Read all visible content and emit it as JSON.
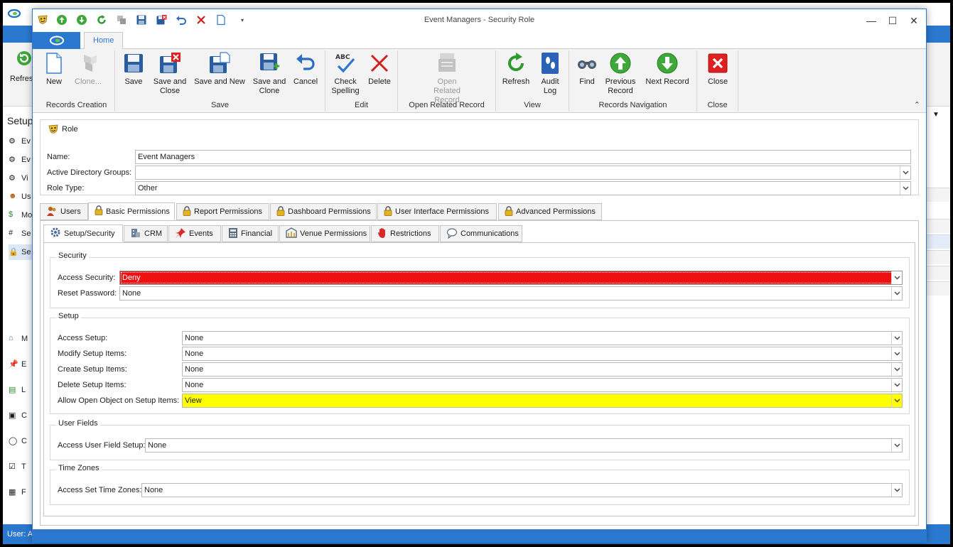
{
  "background": {
    "ribbon_left_label": "Refres",
    "sidebar_header": "Setup",
    "sidebar_items": [
      "Ev",
      "Ev",
      "Vi",
      "Us",
      "Mo",
      "Se",
      "Se"
    ],
    "nav_items": [
      "M",
      "E",
      "L",
      "C",
      "C",
      "T",
      "F"
    ],
    "status_text": "User: A"
  },
  "window": {
    "title": "Event Managers - Security Role",
    "controls": {
      "minimize": "—",
      "maximize": "☐",
      "close": "✕"
    }
  },
  "ribbon": {
    "home_tab": "Home",
    "groups": [
      {
        "label": "Records Creation",
        "buttons": [
          {
            "label": "New",
            "icon": "new-document-icon"
          },
          {
            "label": "Clone...",
            "icon": "clone-icon",
            "disabled": true
          }
        ]
      },
      {
        "label": "Save",
        "buttons": [
          {
            "label": "Save",
            "icon": "save-icon"
          },
          {
            "label": "Save and Close",
            "icon": "save-close-icon"
          },
          {
            "label": "Save and New",
            "icon": "save-new-icon"
          },
          {
            "label": "Save and Clone",
            "icon": "save-clone-icon"
          },
          {
            "label": "Cancel",
            "icon": "undo-icon"
          }
        ]
      },
      {
        "label": "Edit",
        "buttons": [
          {
            "label": "Check Spelling",
            "icon": "spell-check-icon"
          },
          {
            "label": "Delete",
            "icon": "delete-icon"
          }
        ]
      },
      {
        "label": "Open Related Record",
        "buttons": [
          {
            "label": "Open Related Record",
            "icon": "open-related-icon",
            "disabled": true
          }
        ]
      },
      {
        "label": "View",
        "buttons": [
          {
            "label": "Refresh",
            "icon": "refresh-icon"
          },
          {
            "label": "Audit Log",
            "icon": "audit-log-icon"
          }
        ]
      },
      {
        "label": "Records Navigation",
        "buttons": [
          {
            "label": "Find",
            "icon": "binoculars-icon"
          },
          {
            "label": "Previous Record",
            "icon": "arrow-up-icon"
          },
          {
            "label": "Next Record",
            "icon": "arrow-down-icon"
          }
        ]
      },
      {
        "label": "Close",
        "buttons": [
          {
            "label": "Close",
            "icon": "close-red-icon"
          }
        ]
      }
    ]
  },
  "role": {
    "section_title": "Role",
    "name_label": "Name:",
    "name_value": "Event Managers",
    "ad_groups_label": "Active Directory Groups:",
    "ad_groups_value": "",
    "role_type_label": "Role Type:",
    "role_type_value": "Other"
  },
  "main_tabs": [
    "Users",
    "Basic Permissions",
    "Report Permissions",
    "Dashboard Permissions",
    "User Interface Permissions",
    "Advanced Permissions"
  ],
  "sub_tabs": [
    "Setup/Security",
    "CRM",
    "Events",
    "Financial",
    "Venue Permissions",
    "Restrictions",
    "Communications"
  ],
  "security": {
    "title": "Security",
    "access_security_label": "Access Security:",
    "access_security_value": "Deny",
    "reset_password_label": "Reset Password:",
    "reset_password_value": "None"
  },
  "setup": {
    "title": "Setup",
    "rows": [
      {
        "label": "Access Setup:",
        "value": "None"
      },
      {
        "label": "Modify Setup Items:",
        "value": "None"
      },
      {
        "label": "Create Setup Items:",
        "value": "None"
      },
      {
        "label": "Delete Setup Items:",
        "value": "None"
      },
      {
        "label": "Allow Open Object on Setup Items:",
        "value": "View"
      }
    ]
  },
  "user_fields": {
    "title": "User Fields",
    "label": "Access User Field Setup:",
    "value": "None"
  },
  "time_zones": {
    "title": "Time Zones",
    "label": "Access Set Time Zones:",
    "value": "None"
  },
  "colors": {
    "accent": "#2b78d0",
    "deny": "#ee1111",
    "view_highlight": "#ffff00"
  }
}
